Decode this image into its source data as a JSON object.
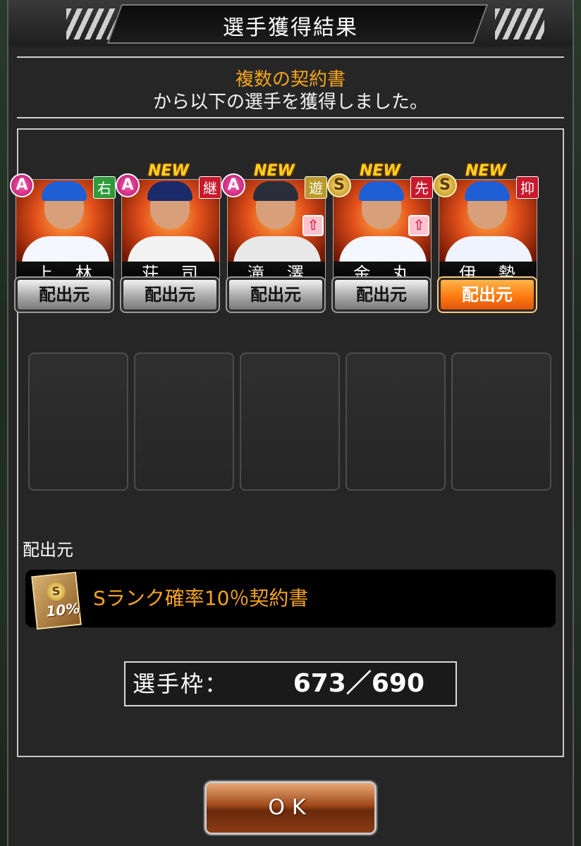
{
  "header": {
    "title": "選手獲得結果"
  },
  "message": {
    "line1": "複数の契約書",
    "line2": "から以下の選手を獲得しました。"
  },
  "players": [
    {
      "name": "上 林",
      "rank": "A",
      "position": "右",
      "position_color": "#2f9a3c",
      "is_new": false,
      "new_label": "",
      "upgrade": false,
      "source_label": "配出元",
      "source_active": false,
      "cap_color": "#1f5fd6",
      "uniform_color": "#f4f7ff"
    },
    {
      "name": "荘 司",
      "rank": "A",
      "position": "継",
      "position_color": "#c8192e",
      "is_new": true,
      "new_label": "NEW",
      "upgrade": false,
      "source_label": "配出元",
      "source_active": false,
      "cap_color": "#1a2a6a",
      "uniform_color": "#f2f2f2"
    },
    {
      "name": "滝 澤",
      "rank": "A",
      "position": "遊",
      "position_color": "#b99a2a",
      "is_new": true,
      "new_label": "NEW",
      "upgrade": true,
      "source_label": "配出元",
      "source_active": false,
      "cap_color": "#2a2e3a",
      "uniform_color": "#e8e8e8"
    },
    {
      "name": "金 丸",
      "rank": "S",
      "position": "先",
      "position_color": "#c8192e",
      "is_new": true,
      "new_label": "NEW",
      "upgrade": true,
      "source_label": "配出元",
      "source_active": false,
      "cap_color": "#1f5fd6",
      "uniform_color": "#f4f7ff"
    },
    {
      "name": "伊 勢",
      "rank": "S",
      "position": "抑",
      "position_color": "#c8192e",
      "is_new": true,
      "new_label": "NEW",
      "upgrade": false,
      "source_label": "配出元",
      "source_active": true,
      "cap_color": "#1f5fd6",
      "uniform_color": "#eef3ff"
    }
  ],
  "empty_slot_count": 5,
  "source_section": {
    "label": "配出元",
    "ticket_name": "Sランク確率10％契約書",
    "ticket_icon_letter": "S",
    "ticket_icon_pct": "10%"
  },
  "roster": {
    "label": "選手枠：",
    "value": "673／690"
  },
  "ok_button": {
    "label": "OK"
  }
}
